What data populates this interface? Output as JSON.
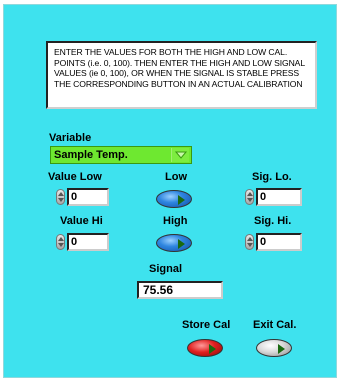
{
  "instructions": {
    "text": "ENTER THE VALUES FOR BOTH THE HIGH AND LOW CAL. POINTS (i.e. 0, 100).  THEN ENTER THE HIGH AND LOW SIGNAL VALUES (ie 0, 100), OR WHEN THE SIGNAL IS STABLE PRESS THE CORRESPONDING BUTTON IN AN ACTUAL CALIBRATION"
  },
  "variable": {
    "label": "Variable",
    "selected": "Sample Temp."
  },
  "value_low": {
    "label": "Value Low",
    "value": "0"
  },
  "value_hi": {
    "label": "Value Hi",
    "value": "0"
  },
  "low_button": {
    "label": "Low"
  },
  "high_button": {
    "label": "High"
  },
  "sig_lo": {
    "label": "Sig. Lo.",
    "value": "0"
  },
  "sig_hi": {
    "label": "Sig. Hi.",
    "value": "0"
  },
  "signal": {
    "label": "Signal",
    "value": "75.56"
  },
  "store_cal": {
    "label": "Store Cal"
  },
  "exit_cal": {
    "label": "Exit Cal."
  },
  "colors": {
    "panel": "#3ee2ee",
    "selector": "#6ee830",
    "low_high_led": "#2f86e0",
    "store_led": "#e02020",
    "exit_led": "#d8d8d8"
  },
  "icons": {
    "spinner": "up-down-spinner-icon",
    "dropdown": "triangle-down-icon",
    "led_indicator": "triangle-right-icon"
  }
}
